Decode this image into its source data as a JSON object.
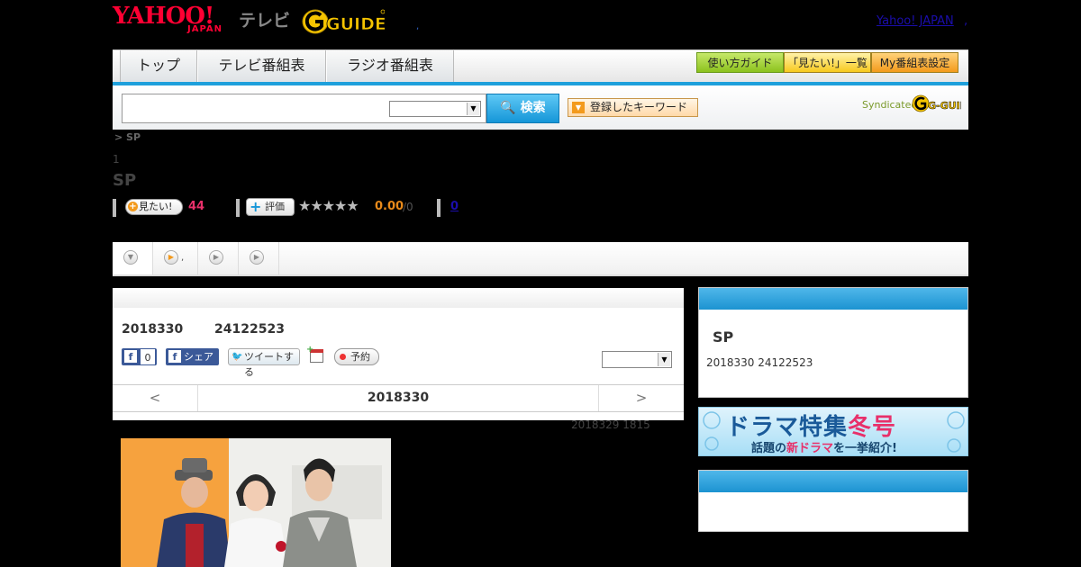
{
  "header": {
    "logo_yahoo": "YAHOO!",
    "logo_japan": "JAPAN",
    "logo_tv": "テレビ",
    "logo_gguide": "G-GUIDE",
    "dot1": ",",
    "yahoo_japan_link": "Yahoo! JAPAN",
    "dot2": ","
  },
  "nav": {
    "tabs": [
      {
        "label": "トップ"
      },
      {
        "label": "テレビ番組表"
      },
      {
        "label": "ラジオ番組表"
      }
    ],
    "buttons": [
      {
        "label": "使い方ガイド"
      },
      {
        "label": "「見たい!」一覧"
      },
      {
        "label": "My番組表設定"
      }
    ]
  },
  "search": {
    "input_value": "",
    "select_value": "",
    "button_label": "検索",
    "keyword_button": "登録したキーワード",
    "syndicated": "Syndicated",
    "syndicated_logo": "G-GUIDE"
  },
  "program": {
    "breadcrumb": "> SP",
    "episode": "1",
    "title": "SP",
    "mitai_label": "見たい!",
    "mitai_count": "44",
    "hyoka_label": "評価",
    "stars": "★★★★★",
    "score": "0.00",
    "score_den": "/0",
    "link_zero": "0"
  },
  "subnav": {
    "tab2_text": ","
  },
  "main": {
    "date": "2018330",
    "time": "24122523",
    "fb_like_count": "0",
    "fb_share_label": "シェア",
    "tweet_label": "ツイートする",
    "yoyaku_label": "予約",
    "select_value": "",
    "date_nav": {
      "prev": "<",
      "current": "2018330",
      "next": ">"
    },
    "updated": "2018329  1815"
  },
  "side": {
    "title": "SP",
    "meta": "2018330  24122523",
    "banner_line1_a": "ドラマ特集",
    "banner_line1_b": "冬号",
    "banner_line2_a": "話題の",
    "banner_line2_b": "新ドラマ",
    "banner_line2_c": "を一挙紹介!"
  },
  "colors": {
    "accent_blue": "#1ea0dc",
    "yahoo_red": "#ff0033",
    "pink_count": "#e8306a",
    "score_orange": "#e88a1a"
  },
  "icons": [
    "search-icon",
    "dropdown-arrow-icon",
    "plus-icon",
    "star-icon",
    "play-icon",
    "facebook-icon",
    "twitter-icon",
    "calendar-add-icon",
    "record-icon"
  ]
}
